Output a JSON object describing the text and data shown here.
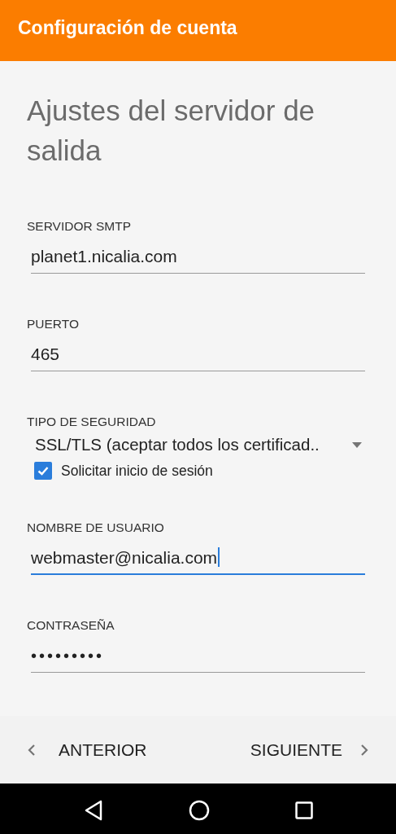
{
  "app_bar": {
    "title": "Configuración de cuenta"
  },
  "heading": "Ajustes del servidor de salida",
  "fields": [
    {
      "kind": "text",
      "label": "SERVIDOR SMTP",
      "value": "planet1.nicalia.com",
      "focused": false
    },
    {
      "kind": "text",
      "label": "PUERTO",
      "value": "465",
      "focused": false
    },
    {
      "kind": "dropdown",
      "label": "TIPO DE SEGURIDAD",
      "value": "SSL/TLS (aceptar todos los certificad.."
    },
    {
      "kind": "checkbox",
      "label": "Solicitar inicio de sesión",
      "checked": true
    },
    {
      "kind": "text",
      "label": "NOMBRE DE USUARIO",
      "value": "webmaster@nicalia.com",
      "focused": true
    },
    {
      "kind": "password",
      "label": "CONTRASEÑA",
      "value": "•••••••••",
      "focused": false
    }
  ],
  "nav_buttons": [
    {
      "kind": "back",
      "label": "ANTERIOR"
    },
    {
      "kind": "next",
      "label": "SIGUIENTE"
    }
  ]
}
